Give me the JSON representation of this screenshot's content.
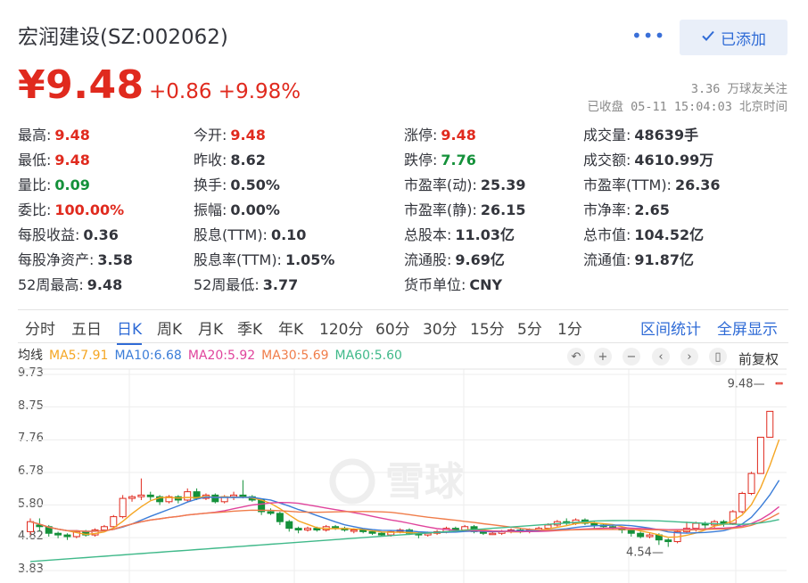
{
  "header": {
    "title": "宏润建设(SZ:002062)",
    "more": "•••",
    "add_button": "已添加",
    "price": "¥9.48",
    "change": "+0.86 +9.98%",
    "followers": "3.36 万球友关注",
    "status": "已收盘 05-11 15:04:03 北京时间"
  },
  "stats": [
    {
      "label": "最高:",
      "value": "9.48",
      "color": "red"
    },
    {
      "label": "今开:",
      "value": "9.48",
      "color": "red"
    },
    {
      "label": "涨停:",
      "value": "9.48",
      "color": "red"
    },
    {
      "label": "成交量:",
      "value": "48639手",
      "color": "dark"
    },
    {
      "label": "最低:",
      "value": "9.48",
      "color": "red"
    },
    {
      "label": "昨收:",
      "value": "8.62",
      "color": "dark"
    },
    {
      "label": "跌停:",
      "value": "7.76",
      "color": "green"
    },
    {
      "label": "成交额:",
      "value": "4610.99万",
      "color": "dark"
    },
    {
      "label": "量比:",
      "value": "0.09",
      "color": "green"
    },
    {
      "label": "换手:",
      "value": "0.50%",
      "color": "dark"
    },
    {
      "label": "市盈率(动):",
      "value": "25.39",
      "color": "dark"
    },
    {
      "label": "市盈率(TTM):",
      "value": "26.36",
      "color": "dark"
    },
    {
      "label": "委比:",
      "value": "100.00%",
      "color": "red"
    },
    {
      "label": "振幅:",
      "value": "0.00%",
      "color": "dark"
    },
    {
      "label": "市盈率(静):",
      "value": "26.15",
      "color": "dark"
    },
    {
      "label": "市净率:",
      "value": "2.65",
      "color": "dark"
    },
    {
      "label": "每股收益:",
      "value": "0.36",
      "color": "dark"
    },
    {
      "label": "股息(TTM):",
      "value": "0.10",
      "color": "dark"
    },
    {
      "label": "总股本:",
      "value": "11.03亿",
      "color": "dark"
    },
    {
      "label": "总市值:",
      "value": "104.52亿",
      "color": "dark"
    },
    {
      "label": "每股净资产:",
      "value": "3.58",
      "color": "dark"
    },
    {
      "label": "股息率(TTM):",
      "value": "1.05%",
      "color": "dark"
    },
    {
      "label": "流通股:",
      "value": "9.69亿",
      "color": "dark"
    },
    {
      "label": "流通值:",
      "value": "91.87亿",
      "color": "dark"
    },
    {
      "label": "52周最高:",
      "value": "9.48",
      "color": "dark"
    },
    {
      "label": "52周最低:",
      "value": "3.77",
      "color": "dark"
    },
    {
      "label": "货币单位:",
      "value": "CNY",
      "color": "dark"
    }
  ],
  "tabs": [
    "分时",
    "五日",
    "日K",
    "周K",
    "月K",
    "季K",
    "年K",
    "120分",
    "60分",
    "30分",
    "15分",
    "5分",
    "1分"
  ],
  "active_tab": "日K",
  "tab_links": [
    "区间统计",
    "全屏显示"
  ],
  "ma_legend": [
    {
      "label": "均线",
      "color": "#333333"
    },
    {
      "label": "MA5:7.91",
      "color": "#f5a623"
    },
    {
      "label": "MA10:6.68",
      "color": "#3b7dd8"
    },
    {
      "label": "MA20:5.92",
      "color": "#e0449c"
    },
    {
      "label": "MA30:5.69",
      "color": "#f07d4a"
    },
    {
      "label": "MA60:5.60",
      "color": "#40b98a"
    }
  ],
  "chart_controls": [
    "↶",
    "+",
    "−",
    "‹",
    "›",
    "▯"
  ],
  "adjust_label": "前复权",
  "watermark": "雪球",
  "colors": {
    "up": "#e02a1e",
    "down": "#14913a",
    "accent": "#2f6bd6"
  },
  "chart_data": {
    "type": "candlestick",
    "y_ticks": [
      "9.73",
      "8.75",
      "7.76",
      "6.78",
      "5.80",
      "4.82",
      "3.83"
    ],
    "ylim": [
      3.83,
      9.73
    ],
    "annotations": {
      "high": "9.48",
      "low": "4.54"
    },
    "candles": [
      [
        5.0,
        5.3,
        4.9,
        5.4
      ],
      [
        5.2,
        5.15,
        5.0,
        5.4
      ],
      [
        5.15,
        4.95,
        4.85,
        5.2
      ],
      [
        4.95,
        4.9,
        4.8,
        5.0
      ],
      [
        4.9,
        4.85,
        4.75,
        4.95
      ],
      [
        4.85,
        5.0,
        4.8,
        5.05
      ],
      [
        5.0,
        4.9,
        4.85,
        5.05
      ],
      [
        4.9,
        5.05,
        4.85,
        5.1
      ],
      [
        5.05,
        5.15,
        5.0,
        5.2
      ],
      [
        5.15,
        5.45,
        5.1,
        5.5
      ],
      [
        5.45,
        6.0,
        5.4,
        6.1
      ],
      [
        6.0,
        6.05,
        5.9,
        6.1
      ],
      [
        6.05,
        6.1,
        5.95,
        6.6
      ],
      [
        6.1,
        6.05,
        5.95,
        6.2
      ],
      [
        6.05,
        5.9,
        5.8,
        6.1
      ],
      [
        5.9,
        6.05,
        5.85,
        6.1
      ],
      [
        6.05,
        5.95,
        5.85,
        6.1
      ],
      [
        5.95,
        6.2,
        5.9,
        6.3
      ],
      [
        6.2,
        6.0,
        5.95,
        6.3
      ],
      [
        6.0,
        6.1,
        5.95,
        6.15
      ],
      [
        6.1,
        5.9,
        5.85,
        6.15
      ],
      [
        5.9,
        6.05,
        5.85,
        6.1
      ],
      [
        6.05,
        6.1,
        5.95,
        6.2
      ],
      [
        6.1,
        6.05,
        6.0,
        6.55
      ],
      [
        6.05,
        5.95,
        5.9,
        6.1
      ],
      [
        5.95,
        5.6,
        5.5,
        6.0
      ],
      [
        5.6,
        5.55,
        5.5,
        5.7
      ],
      [
        5.55,
        5.3,
        5.2,
        5.6
      ],
      [
        5.3,
        5.1,
        5.0,
        5.35
      ],
      [
        5.1,
        5.05,
        4.95,
        5.15
      ],
      [
        5.05,
        5.1,
        5.0,
        5.15
      ],
      [
        5.1,
        5.05,
        5.0,
        5.15
      ],
      [
        5.05,
        5.15,
        5.0,
        5.2
      ],
      [
        5.15,
        5.1,
        5.05,
        5.2
      ],
      [
        5.1,
        5.05,
        5.0,
        5.15
      ],
      [
        5.05,
        5.05,
        4.95,
        5.1
      ],
      [
        5.05,
        5.0,
        4.95,
        5.1
      ],
      [
        5.0,
        4.95,
        4.9,
        5.05
      ],
      [
        4.95,
        4.9,
        4.85,
        5.0
      ],
      [
        4.9,
        5.0,
        4.85,
        5.05
      ],
      [
        5.0,
        5.05,
        4.95,
        5.1
      ],
      [
        5.05,
        4.95,
        4.9,
        5.1
      ],
      [
        4.95,
        4.9,
        4.8,
        5.0
      ],
      [
        4.9,
        4.95,
        4.85,
        5.0
      ],
      [
        4.95,
        5.0,
        4.9,
        5.05
      ],
      [
        5.0,
        5.1,
        4.95,
        5.15
      ],
      [
        5.1,
        5.05,
        5.0,
        5.15
      ],
      [
        5.05,
        5.15,
        5.0,
        5.2
      ],
      [
        5.15,
        5.0,
        4.95,
        5.2
      ],
      [
        5.0,
        4.95,
        4.9,
        5.05
      ],
      [
        4.95,
        4.95,
        4.9,
        5.0
      ],
      [
        4.95,
        5.0,
        4.9,
        5.05
      ],
      [
        5.0,
        5.05,
        4.95,
        5.1
      ],
      [
        5.05,
        5.0,
        4.95,
        5.1
      ],
      [
        5.0,
        5.05,
        4.95,
        5.1
      ],
      [
        5.05,
        5.1,
        5.0,
        5.15
      ],
      [
        5.1,
        5.2,
        5.05,
        5.25
      ],
      [
        5.2,
        5.3,
        5.15,
        5.35
      ],
      [
        5.3,
        5.25,
        5.2,
        5.4
      ],
      [
        5.25,
        5.35,
        5.2,
        5.4
      ],
      [
        5.35,
        5.25,
        5.2,
        5.4
      ],
      [
        5.25,
        5.2,
        5.1,
        5.3
      ],
      [
        5.2,
        5.15,
        5.1,
        5.25
      ],
      [
        5.15,
        5.1,
        5.05,
        5.2
      ],
      [
        5.1,
        5.05,
        4.95,
        5.15
      ],
      [
        5.05,
        4.95,
        4.85,
        5.1
      ],
      [
        4.95,
        4.85,
        4.8,
        5.0
      ],
      [
        4.85,
        4.9,
        4.8,
        4.95
      ],
      [
        4.9,
        4.75,
        4.6,
        4.95
      ],
      [
        4.75,
        4.7,
        4.54,
        4.8
      ],
      [
        4.7,
        5.0,
        4.65,
        5.05
      ],
      [
        5.0,
        5.1,
        4.95,
        5.3
      ],
      [
        5.1,
        5.25,
        5.0,
        5.3
      ],
      [
        5.25,
        5.2,
        5.05,
        5.3
      ],
      [
        5.2,
        5.3,
        5.1,
        5.35
      ],
      [
        5.3,
        5.25,
        5.15,
        5.35
      ],
      [
        5.25,
        5.6,
        5.2,
        5.65
      ],
      [
        5.6,
        6.15,
        5.55,
        6.2
      ],
      [
        6.15,
        6.75,
        6.1,
        6.8
      ],
      [
        6.75,
        7.84,
        6.75,
        7.84
      ],
      [
        7.84,
        8.62,
        8.62,
        8.62
      ],
      [
        9.48,
        9.48,
        9.48,
        9.48
      ]
    ]
  }
}
